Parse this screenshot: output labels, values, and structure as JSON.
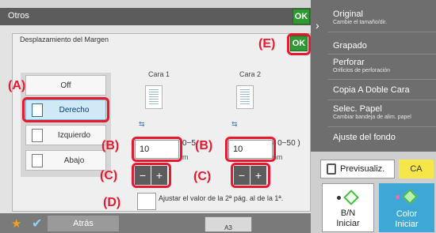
{
  "base": {
    "title": "Otros",
    "ok": "OK",
    "back": "Atrás",
    "paper_size": "A3"
  },
  "right_menu": {
    "items": [
      {
        "label": "Original",
        "sub": "Cambie el tamaño/dir."
      },
      {
        "label": "Grapado",
        "sub": ""
      },
      {
        "label": "Perforar",
        "sub": "Orificios de perforación"
      },
      {
        "label": "Copia A Doble Cara",
        "sub": ""
      },
      {
        "label": "Selec. Papel",
        "sub": "Cambiar bandeja de alim. papel"
      },
      {
        "label": "Ajuste del fondo",
        "sub": ""
      }
    ],
    "preview": "Previsualiz.",
    "ca": "CA",
    "start_bw": {
      "line1": "B/N",
      "line2": "Iniciar"
    },
    "start_color": {
      "line1": "Color",
      "line2": "Iniciar"
    }
  },
  "dialog": {
    "title": "Desplazamiento del Margen",
    "ok": "OK",
    "sides": [
      {
        "label": "Off",
        "active": false
      },
      {
        "label": "Derecho",
        "active": true
      },
      {
        "label": "Izquierdo",
        "active": false
      },
      {
        "label": "Abajo",
        "active": false
      }
    ],
    "cara1": {
      "label": "Cara 1",
      "value": "10",
      "range": "0~5",
      "unit": "m"
    },
    "cara2": {
      "label": "Cara 2",
      "value": "10",
      "range": "( 0~50 )",
      "unit": "nm"
    },
    "minus": "−",
    "plus": "+",
    "checkbox_text": "Ajustar el valor de la 2ª pág. al de la 1ª."
  },
  "callouts": {
    "a": "(A)",
    "b": "(B)",
    "c": "(C)",
    "d": "(D)",
    "e": "(E)"
  },
  "colors": {
    "callout": "#e8182e",
    "ok": "#2f9a34",
    "ca": "#f7e64a",
    "color_start": "#3fa7d6"
  }
}
